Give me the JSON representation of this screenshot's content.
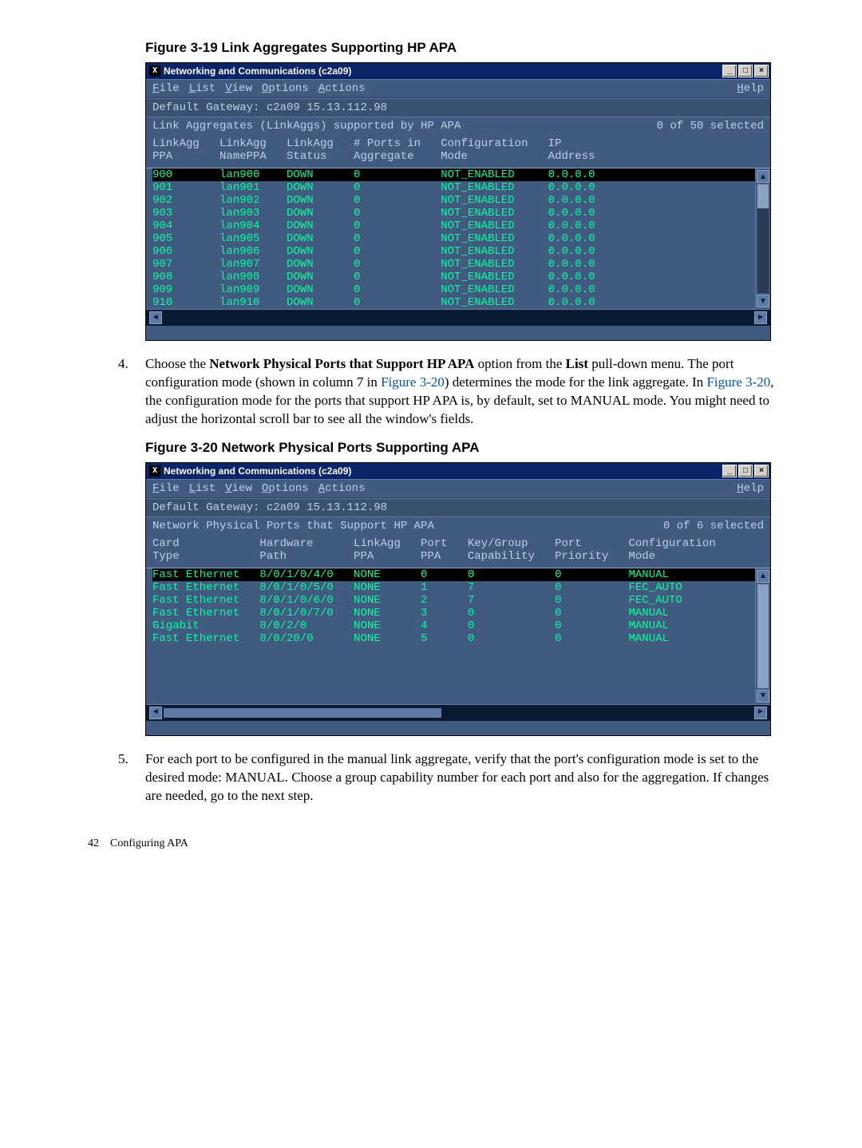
{
  "captions": {
    "fig319": "Figure 3-19 Link Aggregates Supporting HP APA",
    "fig320": "Figure 3-20 Network Physical Ports Supporting APA"
  },
  "xwin_title": "Networking and Communications (c2a09)",
  "menu": {
    "file": "File",
    "list": "List",
    "view": "View",
    "options": "Options",
    "actions": "Actions",
    "help": "Help"
  },
  "gateway_label": "Default Gateway: c2a09  15.13.112.98",
  "win1": {
    "subhead_left": "Link Aggregates (LinkAggs) supported by HP APA",
    "subhead_right": "0 of 50 selected",
    "col_lines": [
      "LinkAgg   LinkAgg   LinkAgg   # Ports in   Configuration   IP",
      "PPA       NamePPA   Status    Aggregate    Mode            Address"
    ],
    "rows": [
      {
        "sel": true,
        "text": "900       lan900    DOWN      0            NOT_ENABLED     0.0.0.0"
      },
      {
        "sel": false,
        "text": "901       lan901    DOWN      0            NOT_ENABLED     0.0.0.0"
      },
      {
        "sel": false,
        "text": "902       lan902    DOWN      0            NOT_ENABLED     0.0.0.0"
      },
      {
        "sel": false,
        "text": "903       lan903    DOWN      0            NOT_ENABLED     0.0.0.0"
      },
      {
        "sel": false,
        "text": "904       lan904    DOWN      0            NOT_ENABLED     0.0.0.0"
      },
      {
        "sel": false,
        "text": "905       lan905    DOWN      0            NOT_ENABLED     0.0.0.0"
      },
      {
        "sel": false,
        "text": "906       lan906    DOWN      0            NOT_ENABLED     0.0.0.0"
      },
      {
        "sel": false,
        "text": "907       lan907    DOWN      0            NOT_ENABLED     0.0.0.0"
      },
      {
        "sel": false,
        "text": "908       lan908    DOWN      0            NOT_ENABLED     0.0.0.0"
      },
      {
        "sel": false,
        "text": "909       lan909    DOWN      0            NOT_ENABLED     0.0.0.0"
      },
      {
        "sel": false,
        "text": "910       lan910    DOWN      0            NOT_ENABLED     0.0.0.0"
      }
    ]
  },
  "win2": {
    "subhead_left": "Network Physical Ports that Support HP APA",
    "subhead_right": "0 of 6 selected",
    "col_lines": [
      "Card            Hardware      LinkAgg   Port   Key/Group    Port       Configuration",
      "Type            Path          PPA       PPA    Capability   Priority   Mode"
    ],
    "rows": [
      {
        "sel": true,
        "text": "Fast Ethernet   8/0/1/0/4/0   NONE      0      0            0          MANUAL"
      },
      {
        "sel": false,
        "text": "Fast Ethernet   8/0/1/0/5/0   NONE      1      7            0          FEC_AUTO"
      },
      {
        "sel": false,
        "text": "Fast Ethernet   8/0/1/0/6/0   NONE      2      7            0          FEC_AUTO"
      },
      {
        "sel": false,
        "text": "Fast Ethernet   8/0/1/0/7/0   NONE      3      0            0          MANUAL"
      },
      {
        "sel": false,
        "text": "Gigabit         8/0/2/0       NONE      4      0            0          MANUAL"
      },
      {
        "sel": false,
        "text": "Fast Ethernet   8/0/20/0      NONE      5      0            0          MANUAL"
      }
    ]
  },
  "step4": {
    "num": "4.",
    "p1a": "Choose the ",
    "p1b": "Network Physical Ports that Support HP APA",
    "p1c": " option from the ",
    "p1d": "List",
    "p1e": " pull-down menu. The port configuration mode (shown in column 7 in ",
    "p1f": "Figure 3-20",
    "p1g": ") determines the mode for the link aggregate. In ",
    "p1h": "Figure 3-20",
    "p1i": ", the configuration mode for the ports that support HP APA is, by default, set to MANUAL mode. You might need to adjust the horizontal scroll bar to see all the window's fields."
  },
  "step5": {
    "num": "5.",
    "text": "For each port to be configured in the manual link aggregate, verify that the port's configuration mode is set to the desired mode: MANUAL. Choose a group capability number for each port and also for the aggregation. If changes are needed, go to the next step."
  },
  "footer": {
    "page": "42",
    "section": "Configuring APA"
  },
  "winbtns": {
    "min": "_",
    "max": "□",
    "close": "×"
  },
  "arrows": {
    "up": "▲",
    "down": "▼",
    "left": "◄",
    "right": "►"
  }
}
